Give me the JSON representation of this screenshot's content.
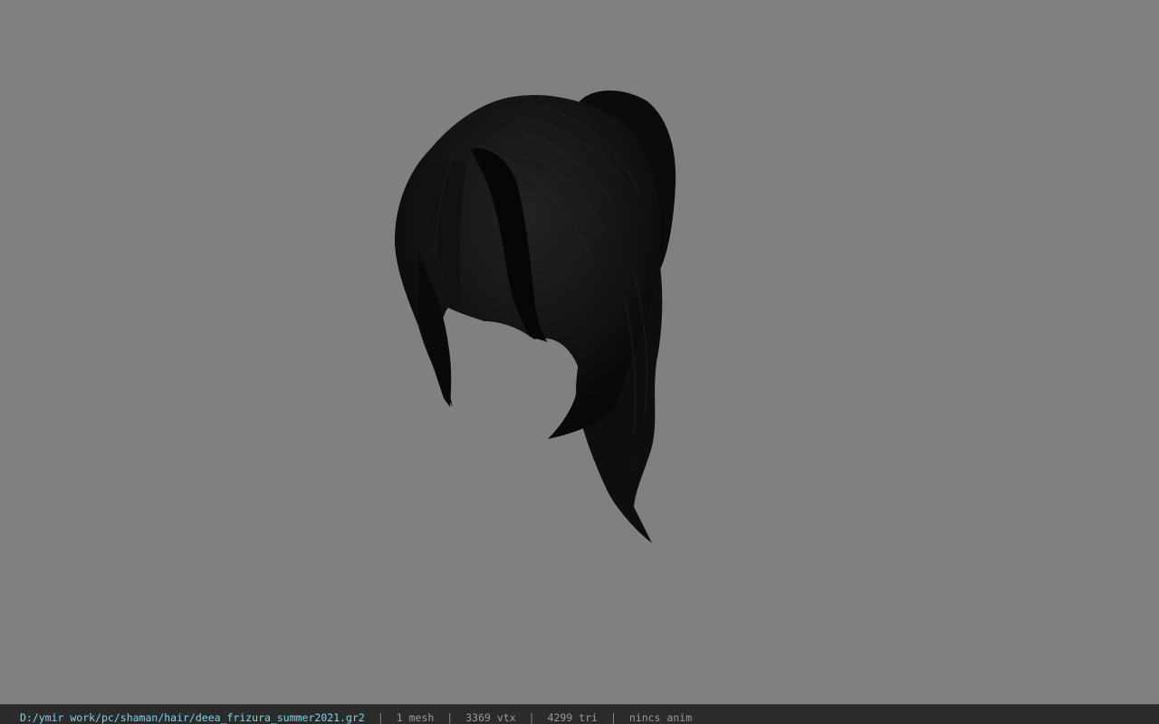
{
  "status_bar": {
    "file_path": "D:/ymir work/pc/shaman/hair/deea_frizura_summer2021.gr2",
    "separator": "|",
    "mesh_count": "1 mesh",
    "vertex_count": "3369 vtx",
    "triangle_count": "4299 tri",
    "animation": "nincs anim"
  },
  "colors": {
    "viewport_background": "#808080",
    "status_bar_background": "#2b2b2b",
    "path_text": "#7fd3e8",
    "info_text": "#9a9a9a",
    "model": "#0d0d0d"
  },
  "viewport": {
    "model": "hair-mesh"
  }
}
